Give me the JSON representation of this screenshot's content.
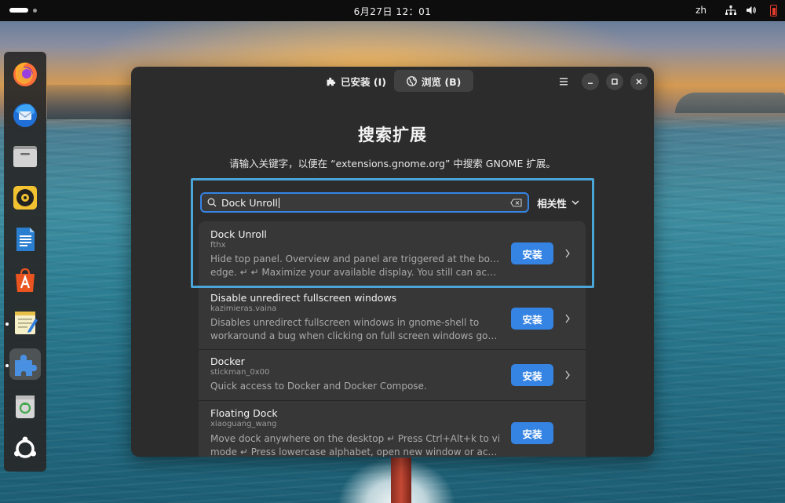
{
  "topbar": {
    "clock": "6月27日  12：01",
    "language": "zh"
  },
  "dock": {
    "apps": [
      {
        "name": "Firefox",
        "icon": "firefox-icon"
      },
      {
        "name": "Thunderbird",
        "icon": "thunderbird-icon"
      },
      {
        "name": "Files",
        "icon": "files-icon"
      },
      {
        "name": "Rhythmbox",
        "icon": "rhythmbox-icon"
      },
      {
        "name": "LibreOffice Writer",
        "icon": "writer-icon"
      },
      {
        "name": "App Center",
        "icon": "app-center-icon"
      },
      {
        "name": "Text Editor",
        "icon": "text-editor-icon"
      },
      {
        "name": "Extension Manager",
        "icon": "extension-manager-icon"
      },
      {
        "name": "Trash",
        "icon": "trash-icon"
      },
      {
        "name": "Show Apps",
        "icon": "show-apps-icon"
      }
    ]
  },
  "window": {
    "tabs": {
      "installed": "已安装 (I)",
      "browse": "浏览 (B)"
    },
    "title": "搜索扩展",
    "subtitle": "请输入关键字，以便在 “extensions.gnome.org” 中搜索 GNOME 扩展。",
    "search": {
      "value": "Dock Unroll"
    },
    "sort": {
      "label": "相关性"
    },
    "results": [
      {
        "name": "Dock Unroll",
        "author": "fthx",
        "desc_line1": "Hide top panel. Overview and panel are triggered at the bottom",
        "desc_line2": "edge. ↵ ↵ Maximize your available display. You still can access t…",
        "button": "安装"
      },
      {
        "name": "Disable unredirect fullscreen windows",
        "author": "kazimieras.vaina",
        "desc_line1": "Disables unredirect fullscreen windows in gnome-shell to",
        "desc_line2": "workaround a bug when clicking on full screen windows goes thro…",
        "button": "安装"
      },
      {
        "name": "Docker",
        "author": "stickman_0x00",
        "desc_line1": "Quick access to Docker and Docker Compose.",
        "desc_line2": "",
        "button": "安装"
      },
      {
        "name": "Floating Dock",
        "author": "xiaoguang_wang",
        "desc_line1": "Move dock anywhere on the desktop ↵ Press Ctrl+Alt+k to vi",
        "desc_line2": "mode ↵ Press lowercase alphabet, open new window or active th…",
        "button": "安装"
      }
    ]
  },
  "colors": {
    "accent": "#3584e4",
    "highlight": "#4aa6d9",
    "window_bg": "#2c2c2c",
    "row_bg": "#373737"
  }
}
